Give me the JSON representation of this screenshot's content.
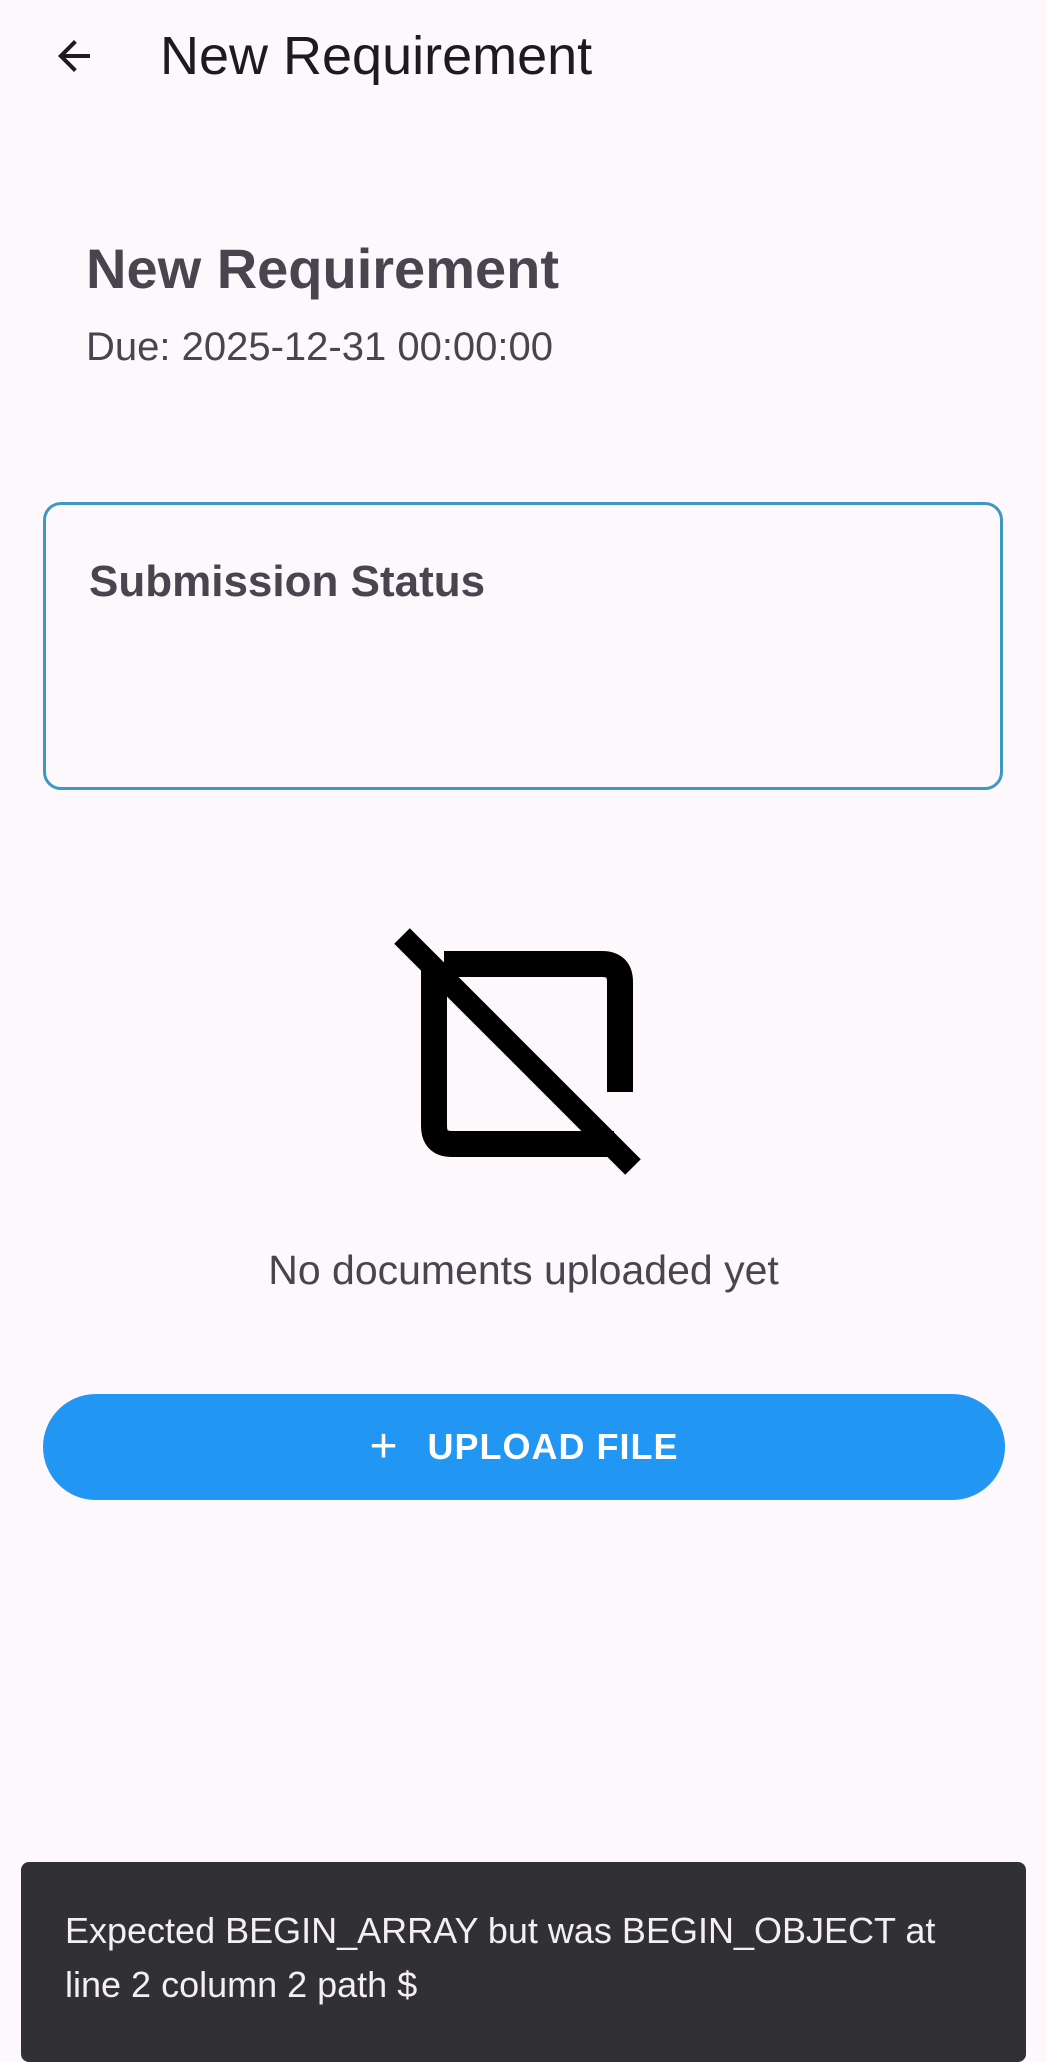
{
  "app_bar": {
    "title": "New Requirement",
    "back_icon": "arrow-back-icon"
  },
  "requirement": {
    "title": "New Requirement",
    "due": "Due: 2025-12-31 00:00:00"
  },
  "status_card": {
    "title": "Submission Status",
    "border_color": "#3F97C3"
  },
  "empty_state": {
    "icon": "no-document-icon",
    "message": "No documents uploaded yet"
  },
  "upload_button": {
    "icon": "plus-icon",
    "plus_glyph": "+",
    "label": "UPLOAD FILE",
    "color": "#2196F3"
  },
  "snackbar": {
    "message": "Expected BEGIN_ARRAY but was BEGIN_OBJECT at line 2 column 2 path $"
  },
  "colors": {
    "background": "#FCF8FC",
    "text": "#49454F",
    "snackbar_bg": "#313033"
  }
}
